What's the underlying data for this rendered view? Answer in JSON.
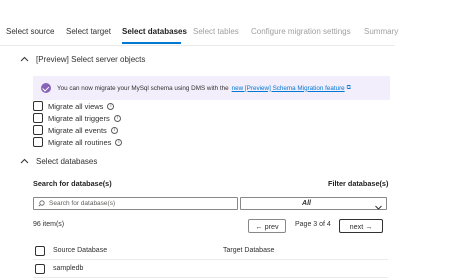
{
  "tabs": [
    {
      "label": "Select source",
      "state": "normal"
    },
    {
      "label": "Select target",
      "state": "normal"
    },
    {
      "label": "Select databases",
      "state": "active"
    },
    {
      "label": "Select tables",
      "state": "disabled"
    },
    {
      "label": "Configure migration settings",
      "state": "disabled"
    },
    {
      "label": "Summary",
      "state": "disabled"
    }
  ],
  "server_objects": {
    "header": "[Preview] Select server objects",
    "banner": {
      "text": "You can now migrate your MySql schema using DMS with the",
      "link": "new [Preview] Schema Migration feature",
      "icon": "check-circle-icon",
      "color": "#8764b8"
    },
    "options": [
      {
        "label": "Migrate all views",
        "checked": false
      },
      {
        "label": "Migrate all triggers",
        "checked": false
      },
      {
        "label": "Migrate all events",
        "checked": false
      },
      {
        "label": "Migrate all routines",
        "checked": false
      }
    ]
  },
  "databases": {
    "header": "Select databases",
    "search_label": "Search for database(s)",
    "search_placeholder": "Search for database(s)",
    "filter_label": "Filter database(s)",
    "filter_value": "All",
    "item_count": "96 item(s)",
    "prev_label": "← prev",
    "page_text": "Page 3 of 4",
    "next_label": "next →",
    "columns": [
      "Source Database",
      "Target Database"
    ],
    "rows": [
      {
        "source": "sampledb",
        "target": ""
      }
    ]
  },
  "colors": {
    "accent": "#0078d4",
    "banner_bg": "#f3eefb"
  }
}
